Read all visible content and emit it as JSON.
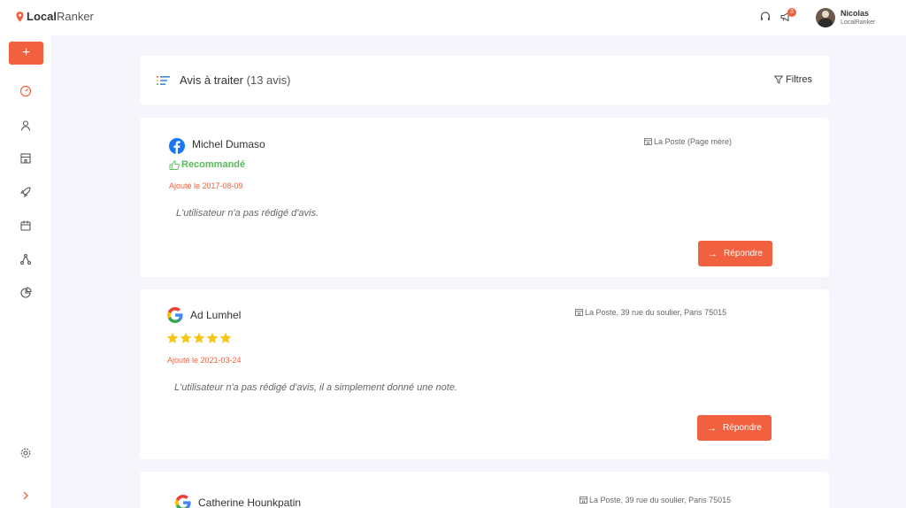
{
  "app": {
    "logo_part1": "Local",
    "logo_part2": "Ranker",
    "notification_count": "3",
    "user_name": "Nicolas",
    "user_org": "LocalRanker"
  },
  "sidebar": {
    "add_label": "+",
    "items": [
      "dashboard-icon",
      "user-icon",
      "store-icon",
      "rocket-icon",
      "calendar-icon",
      "network-icon",
      "pie-chart-icon",
      "settings-icon",
      "expand-icon"
    ]
  },
  "header": {
    "title": "Avis à traiter",
    "count": "(13 avis)",
    "filter_label": "Filtres"
  },
  "reviews": [
    {
      "source": "facebook",
      "name": "Michel Dumaso",
      "location": "La Poste (Page mère)",
      "recommendation": "Recommandé",
      "date": "Ajouté le 2017-08-09",
      "text": "L'utilisateur n'a pas rédigé d'avis.",
      "reply_label": "Répondre"
    },
    {
      "source": "google",
      "name": "Ad Lumhel",
      "location": "La Poste, 39 rue du soulier, Paris 75015",
      "rating": 5,
      "date": "Ajouté le 2021-03-24",
      "text": "L'utilisateur n'a pas rédigé d'avis, il a simplement donné une note.",
      "reply_label": "Répondre"
    },
    {
      "source": "google",
      "name": "Catherine Hounkpatin",
      "location": "La Poste, 39 rue du soulier, Paris 75015"
    }
  ],
  "colors": {
    "accent": "#f2613f",
    "recommend": "#5cb85c",
    "star": "#f5c518",
    "facebook": "#1877f2"
  }
}
